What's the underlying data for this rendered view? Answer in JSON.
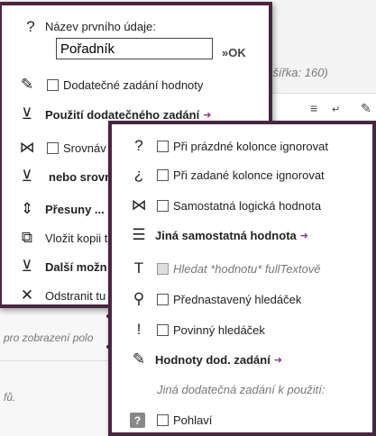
{
  "background": {
    "hint": "vá šířka: 160)",
    "text1": "pro zobrazení polo",
    "text2": "fů."
  },
  "menu1": {
    "name_label": "Název prvního údaje:",
    "name_value": "Pořadník",
    "ok_label": "»OK",
    "items": [
      {
        "label": "Dodatečné zadání hodnoty"
      },
      {
        "label": "Použití dodatečného zadání"
      },
      {
        "label": "Srovnáv"
      },
      {
        "label": "nebo srovn"
      },
      {
        "label": "Přesuny ..."
      },
      {
        "label": "Vložit kopii t"
      },
      {
        "label": "Další možn"
      },
      {
        "label": "Odstranit tu"
      }
    ]
  },
  "menu2": {
    "items": [
      {
        "label": "Při prázdné kolonce ignorovat"
      },
      {
        "label": "Při zadané kolonce ignorovat"
      },
      {
        "label": "Samostatná logická hodnota"
      },
      {
        "label": "Jiná samostatná hodnota"
      },
      {
        "label": "Hledat *hodnotu* fullTextově"
      },
      {
        "label": "Přednastavený hledáček"
      },
      {
        "label": "Povinný hledáček"
      },
      {
        "label": "Hodnoty dod. zadání"
      },
      {
        "label": "Jiná dodatečná zadání k použití:"
      },
      {
        "label": "Pohlaví"
      }
    ]
  },
  "colors": {
    "menu_border": "#4a2540",
    "arrow": "#8b3a8b"
  }
}
